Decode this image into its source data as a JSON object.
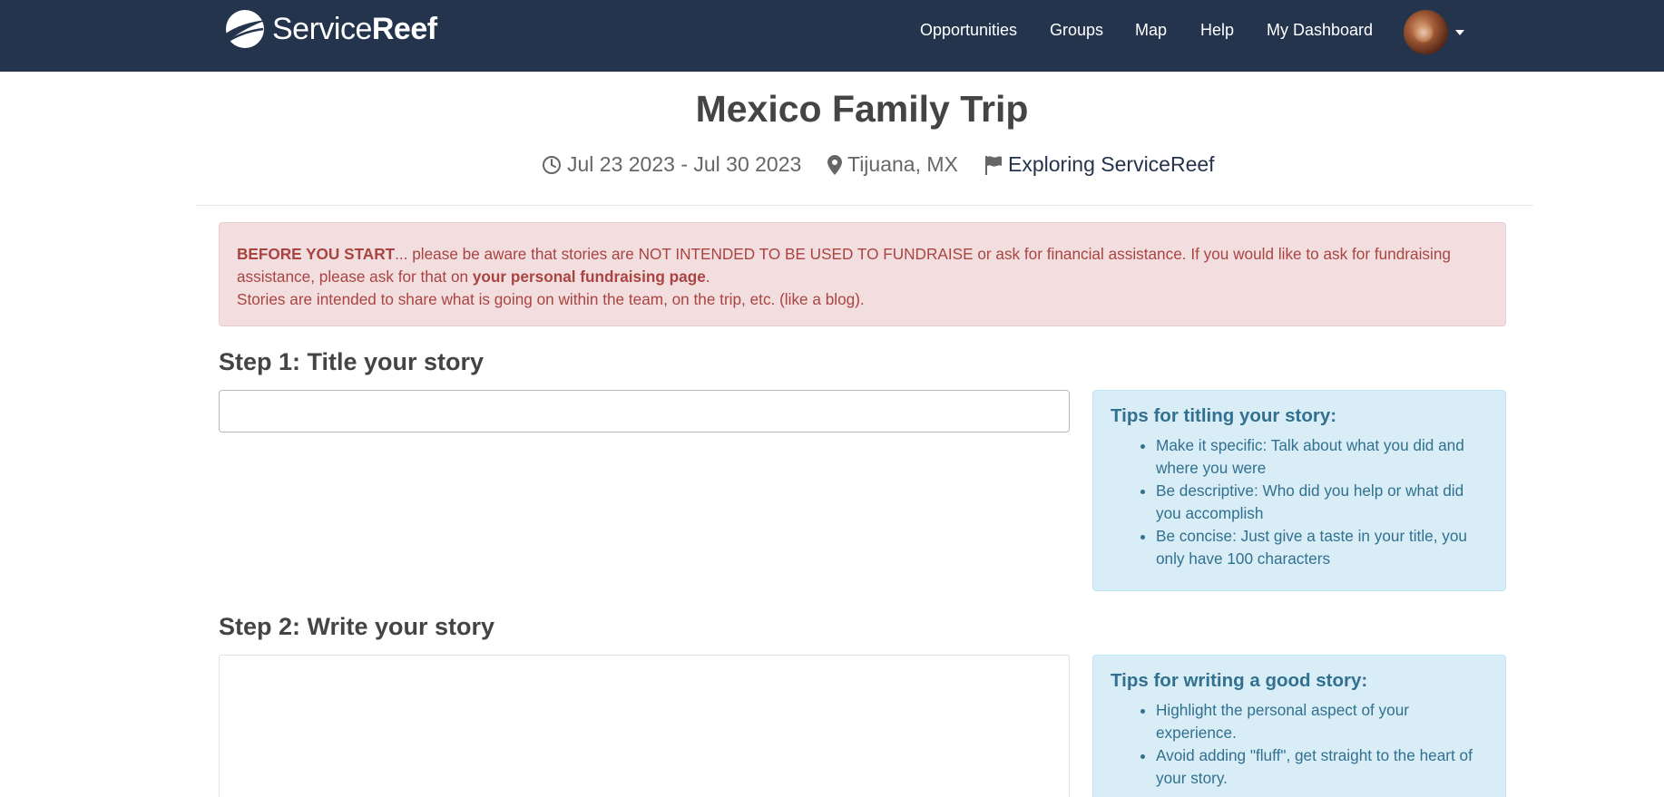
{
  "nav": {
    "logo": {
      "part1": "Service",
      "part2": "Reef"
    },
    "links": [
      "Opportunities",
      "Groups",
      "Map",
      "Help",
      "My Dashboard"
    ]
  },
  "trip": {
    "title": "Mexico Family Trip",
    "dates": "Jul 23 2023 - Jul 30 2023",
    "location": "Tijuana, MX",
    "organization": "Exploring ServiceReef"
  },
  "alert": {
    "lead": "BEFORE YOU START",
    "text1": "... please be aware that stories are NOT INTENDED TO BE USED TO FUNDRAISE or ask for financial assistance. If you would like to ask for fundraising assistance, please ask for that on ",
    "link": "your personal fundraising page",
    "text2": ".",
    "text3": "Stories are intended to share what is going on within the team, on the trip, etc. (like a blog)."
  },
  "step1": {
    "title": "Step 1: Title your story",
    "input_value": "",
    "tips_title": "Tips for titling your story:",
    "tips": [
      "Make it specific: Talk about what you did and where you were",
      "Be descriptive: Who did you help or what did you accomplish",
      "Be concise: Just give a taste in your title, you only have 100 characters"
    ]
  },
  "step2": {
    "title": "Step 2: Write your story",
    "tips_title": "Tips for writing a good story:",
    "tips": [
      "Highlight the personal aspect of your experience.",
      "Avoid adding \"fluff\", get straight to the heart of your story."
    ]
  },
  "colors": {
    "navbar": "#24344d",
    "alert_bg": "#f2dede",
    "alert_text": "#a94442",
    "tips_bg": "#d9edf7",
    "tips_text": "#31708f"
  }
}
